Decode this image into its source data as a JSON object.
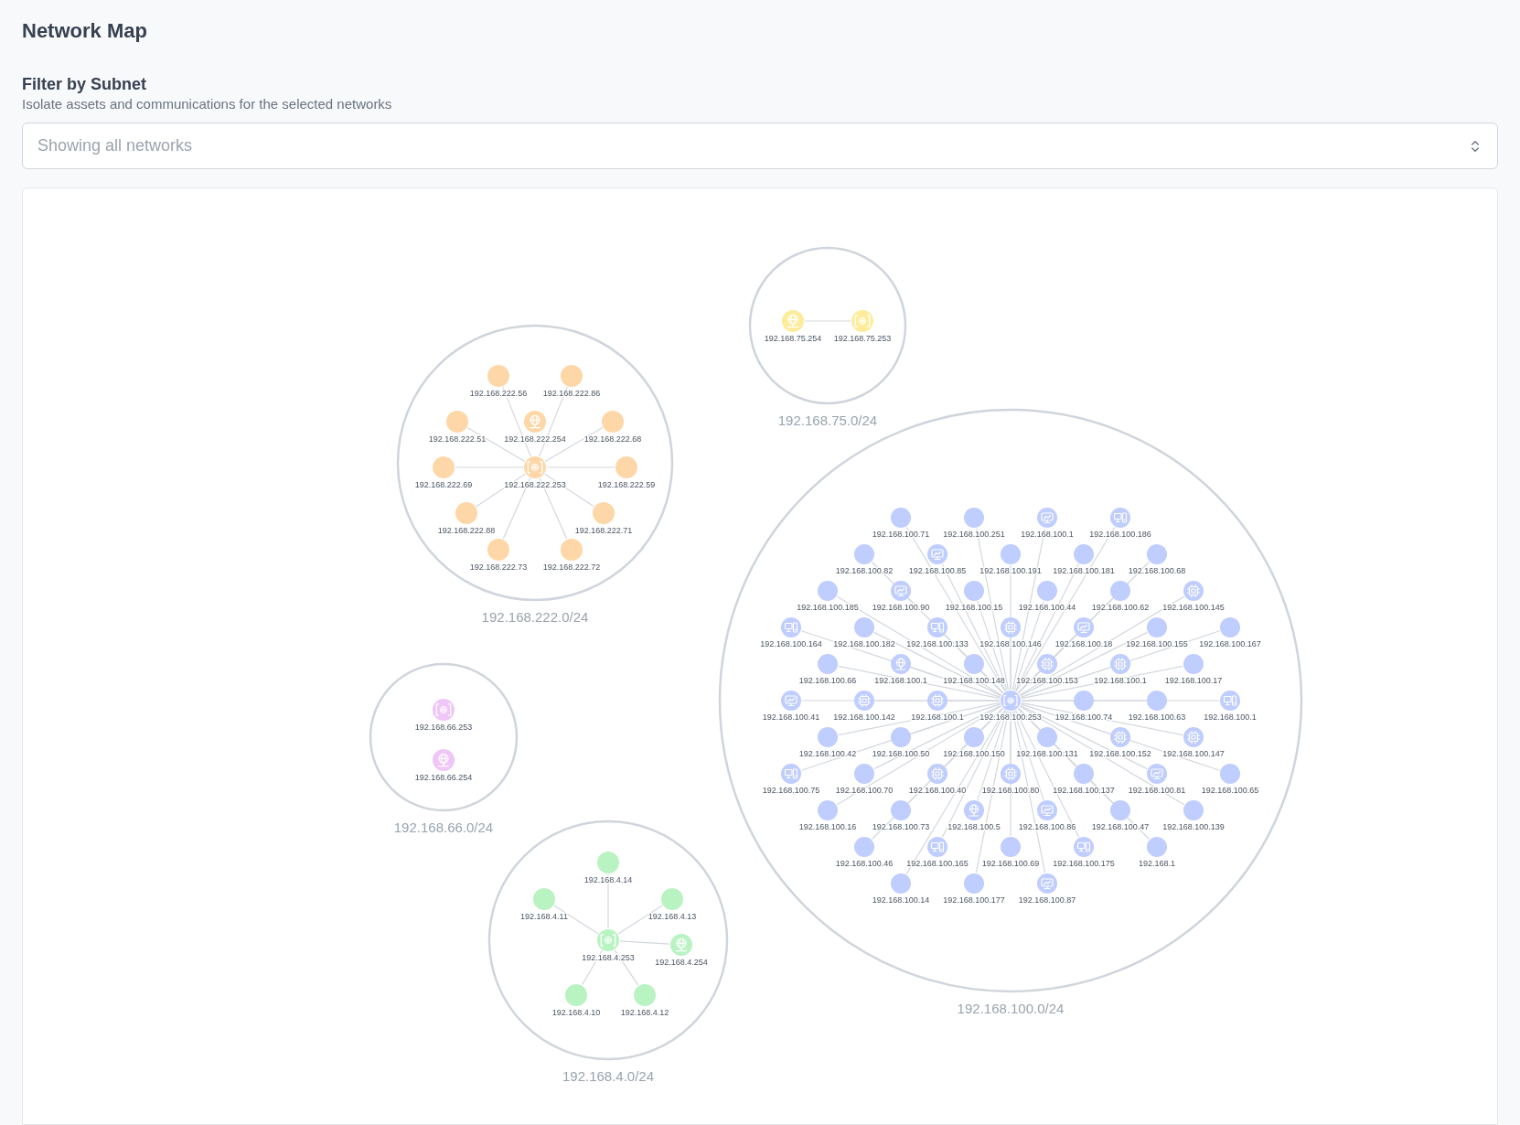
{
  "title": "Network Map",
  "filter": {
    "label": "Filter by Subnet",
    "description": "Isolate assets and communications for the selected networks",
    "placeholder": "Showing all networks"
  },
  "subnets": [
    {
      "name": "192.168.222.0/24",
      "color": "#fed7a8",
      "nodes": [
        {
          "label": "192.168.222.254",
          "kind": "globe"
        },
        {
          "label": "192.168.222.253",
          "kind": "scan"
        },
        {
          "label": "192.168.222.56",
          "kind": "host"
        },
        {
          "label": "192.168.222.86",
          "kind": "host"
        },
        {
          "label": "192.168.222.51",
          "kind": "host"
        },
        {
          "label": "192.168.222.68",
          "kind": "host"
        },
        {
          "label": "192.168.222.69",
          "kind": "host"
        },
        {
          "label": "192.168.222.59",
          "kind": "host"
        },
        {
          "label": "192.168.222.88",
          "kind": "host"
        },
        {
          "label": "192.168.222.71",
          "kind": "host"
        },
        {
          "label": "192.168.222.73",
          "kind": "host"
        },
        {
          "label": "192.168.222.72",
          "kind": "host"
        }
      ]
    },
    {
      "name": "192.168.75.0/24",
      "color": "#fdec9c",
      "nodes": [
        {
          "label": "192.168.75.254",
          "kind": "globe"
        },
        {
          "label": "192.168.75.253",
          "kind": "scan"
        }
      ]
    },
    {
      "name": "192.168.66.0/24",
      "color": "#efc6f7",
      "nodes": [
        {
          "label": "192.168.66.253",
          "kind": "scan"
        },
        {
          "label": "192.168.66.254",
          "kind": "globe"
        }
      ]
    },
    {
      "name": "192.168.100.0/24",
      "color": "#bfcdff",
      "nodes": [
        {
          "label": "192.168.100.253",
          "kind": "scan"
        },
        {
          "label": "192.168.100.148",
          "kind": "host"
        },
        {
          "label": "192.168.100.153",
          "kind": "chip"
        },
        {
          "label": "192.168.100.150",
          "kind": "host"
        },
        {
          "label": "192.168.100.131",
          "kind": "host"
        },
        {
          "label": "192.168.100.1",
          "kind": "chip"
        },
        {
          "label": "192.168.100.74",
          "kind": "host"
        },
        {
          "label": "192.168.100.146",
          "kind": "chip"
        },
        {
          "label": "192.168.100.80",
          "kind": "chip"
        },
        {
          "label": "192.168.100.1",
          "kind": "globe"
        },
        {
          "label": "192.168.100.1",
          "kind": "chip"
        },
        {
          "label": "192.168.100.50",
          "kind": "host"
        },
        {
          "label": "192.168.100.152",
          "kind": "chip"
        },
        {
          "label": "192.168.100.133",
          "kind": "desktop"
        },
        {
          "label": "192.168.100.18",
          "kind": "monitor"
        },
        {
          "label": "192.168.100.40",
          "kind": "chip"
        },
        {
          "label": "192.168.100.137",
          "kind": "host"
        },
        {
          "label": "192.168.100.142",
          "kind": "chip"
        },
        {
          "label": "192.168.100.63",
          "kind": "host"
        },
        {
          "label": "192.168.100.15",
          "kind": "host"
        },
        {
          "label": "192.168.100.44",
          "kind": "host"
        },
        {
          "label": "192.168.100.5",
          "kind": "globe"
        },
        {
          "label": "192.168.100.86",
          "kind": "monitor"
        },
        {
          "label": "192.168.100.182",
          "kind": "host"
        },
        {
          "label": "192.168.100.155",
          "kind": "host"
        },
        {
          "label": "192.168.100.70",
          "kind": "host"
        },
        {
          "label": "192.168.100.81",
          "kind": "monitor"
        },
        {
          "label": "192.168.100.66",
          "kind": "host"
        },
        {
          "label": "192.168.100.17",
          "kind": "host"
        },
        {
          "label": "192.168.100.42",
          "kind": "host"
        },
        {
          "label": "192.168.100.147",
          "kind": "chip"
        },
        {
          "label": "192.168.100.90",
          "kind": "monitor"
        },
        {
          "label": "192.168.100.62",
          "kind": "host"
        },
        {
          "label": "192.168.100.73",
          "kind": "host"
        },
        {
          "label": "192.168.100.47",
          "kind": "host"
        },
        {
          "label": "192.168.100.191",
          "kind": "host"
        },
        {
          "label": "192.168.100.69",
          "kind": "host"
        },
        {
          "label": "192.168.100.41",
          "kind": "monitor"
        },
        {
          "label": "192.168.100.1",
          "kind": "desktop"
        },
        {
          "label": "192.168.100.85",
          "kind": "monitor"
        },
        {
          "label": "192.168.100.181",
          "kind": "host"
        },
        {
          "label": "192.168.100.165",
          "kind": "desktop"
        },
        {
          "label": "192.168.100.175",
          "kind": "desktop"
        },
        {
          "label": "192.168.100.185",
          "kind": "host"
        },
        {
          "label": "192.168.100.145",
          "kind": "chip"
        },
        {
          "label": "192.168.100.164",
          "kind": "desktop"
        },
        {
          "label": "192.168.100.167",
          "kind": "host"
        },
        {
          "label": "192.168.100.75",
          "kind": "desktop"
        },
        {
          "label": "192.168.100.65",
          "kind": "host"
        },
        {
          "label": "192.168.100.16",
          "kind": "host"
        },
        {
          "label": "192.168.100.139",
          "kind": "host"
        },
        {
          "label": "192.168.100.82",
          "kind": "host"
        },
        {
          "label": "192.168.100.68",
          "kind": "host"
        },
        {
          "label": "192.168.100.46",
          "kind": "host"
        },
        {
          "label": "192.168.1",
          "kind": "host"
        },
        {
          "label": "192.168.100.251",
          "kind": "host"
        },
        {
          "label": "192.168.100.1",
          "kind": "monitor"
        },
        {
          "label": "192.168.100.177",
          "kind": "host"
        },
        {
          "label": "192.168.100.87",
          "kind": "monitor"
        },
        {
          "label": "192.168.100.71",
          "kind": "host"
        },
        {
          "label": "192.168.100.186",
          "kind": "desktop"
        },
        {
          "label": "192.168.100.14",
          "kind": "host"
        }
      ]
    },
    {
      "name": "192.168.4.0/24",
      "color": "#b9f3c2",
      "nodes": [
        {
          "label": "192.168.4.253",
          "kind": "scan"
        },
        {
          "label": "192.168.4.254",
          "kind": "globe"
        },
        {
          "label": "192.168.4.14",
          "kind": "host"
        },
        {
          "label": "192.168.4.11",
          "kind": "host"
        },
        {
          "label": "192.168.4.13",
          "kind": "host"
        },
        {
          "label": "192.168.4.10",
          "kind": "host"
        },
        {
          "label": "192.168.4.12",
          "kind": "host"
        }
      ]
    }
  ]
}
